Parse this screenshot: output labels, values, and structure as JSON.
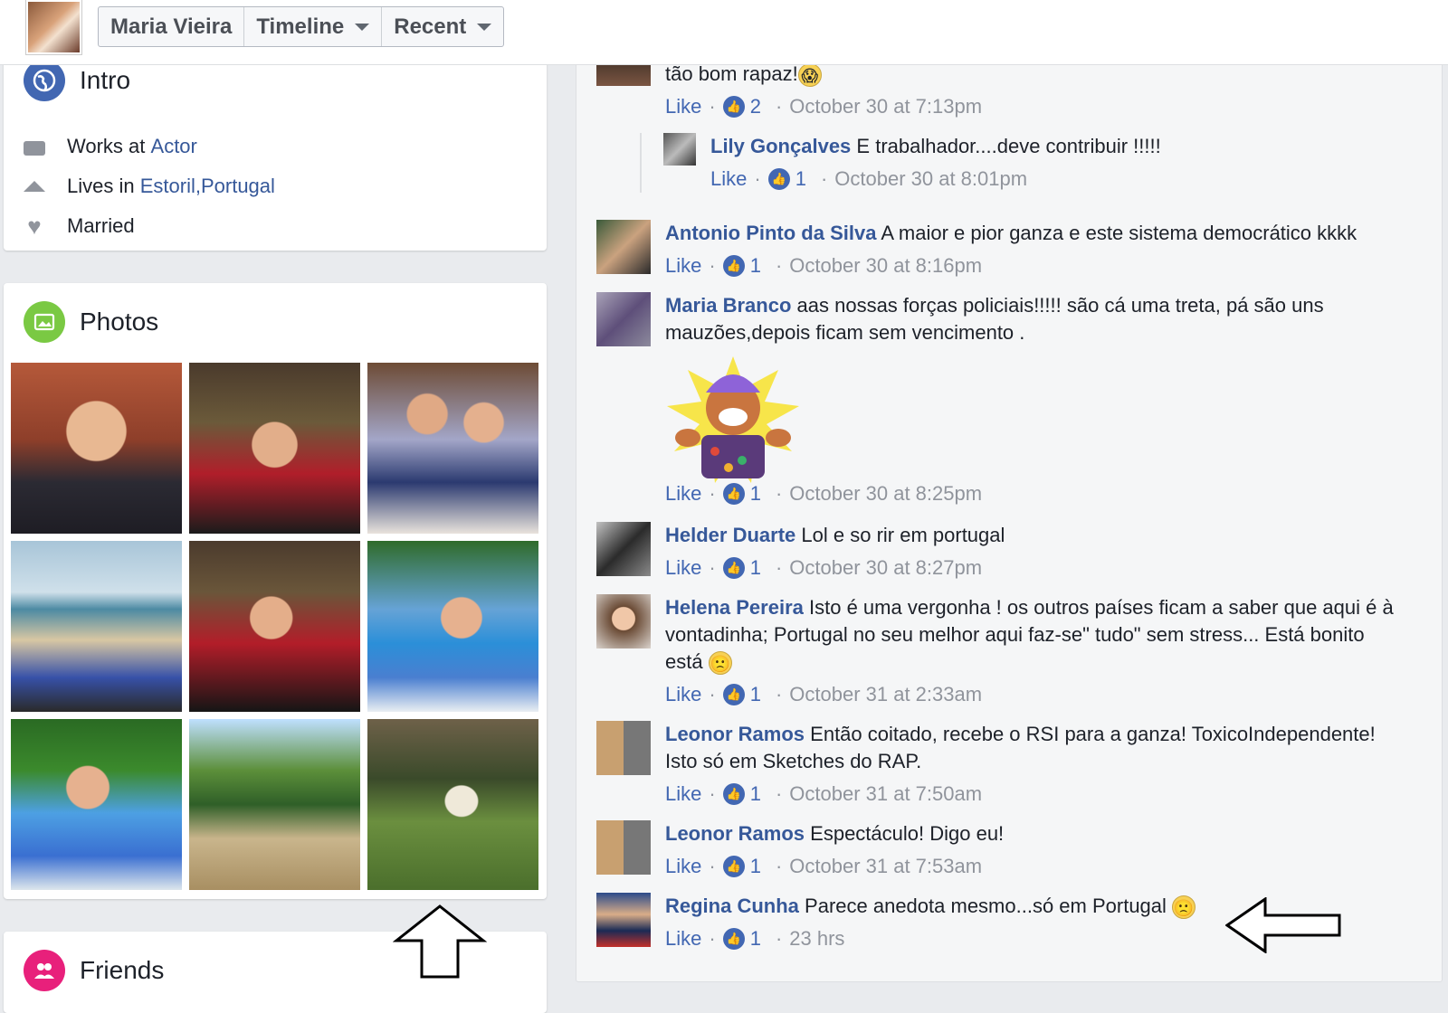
{
  "header": {
    "profile_name": "Maria Vieira",
    "timeline_label": "Timeline",
    "recent_label": "Recent"
  },
  "intro": {
    "title": "Intro",
    "works_prefix": "Works at ",
    "works_link": "Actor",
    "lives_prefix": "Lives in ",
    "lives_city": "Estoril",
    "lives_sep": ", ",
    "lives_country": "Portugal",
    "relationship": "Married"
  },
  "photos": {
    "title": "Photos"
  },
  "friends": {
    "title": "Friends"
  },
  "colors": {
    "brand": "#4267b2",
    "link": "#365899",
    "meta": "#90949c",
    "background": "#e9ebee"
  },
  "comments": [
    {
      "author": "",
      "text": "tão bom rapaz!",
      "emoji": "😱",
      "like": "Like",
      "count": "2",
      "time": "October 30 at 7:13pm"
    },
    {
      "author": "Lily Gonçalves",
      "text": "E trabalhador....deve contribuir !!!!!",
      "like": "Like",
      "count": "1",
      "time": "October 30 at 8:01pm"
    },
    {
      "author": "Antonio Pinto da Silva",
      "text": "A maior e pior ganza e este sistema democrático kkkk",
      "like": "Like",
      "count": "1",
      "time": "October 30 at 8:16pm"
    },
    {
      "author": "Maria Branco",
      "text": "aas nossas forças policiais!!!!! são cá uma treta, pá são uns mauzões,depois ficam sem vencimento .",
      "like": "Like",
      "count": "1",
      "time": "October 30 at 8:25pm"
    },
    {
      "author": "Helder Duarte",
      "text": "Lol e so rir em portugal",
      "like": "Like",
      "count": "1",
      "time": "October 30 at 8:27pm"
    },
    {
      "author": "Helena Pereira",
      "text": "Isto é uma vergonha ! os outros países ficam a saber que aqui é à vontadinha; Portugal no seu melhor aqui faz-se\" tudo\" sem stress... Está bonito está",
      "emoji": "🙁",
      "like": "Like",
      "count": "1",
      "time": "October 31 at 2:33am"
    },
    {
      "author": "Leonor Ramos",
      "text": "Então coitado, recebe o RSI para a ganza! ToxicoIndependente! Isto só em Sketches do RAP.",
      "like": "Like",
      "count": "1",
      "time": "October 31 at 7:50am"
    },
    {
      "author": "Leonor Ramos",
      "text": "Espectáculo! Digo eu!",
      "like": "Like",
      "count": "1",
      "time": "October 31 at 7:53am"
    },
    {
      "author": "Regina Cunha",
      "text": "Parece anedota mesmo...só em Portugal",
      "emoji": "🙁",
      "like": "Like",
      "count": "1",
      "time": "23 hrs"
    }
  ],
  "icons": {
    "like_badge": "thumbs-up-icon",
    "intro": "globe-icon",
    "photos": "photo-icon",
    "friends": "friends-icon"
  }
}
